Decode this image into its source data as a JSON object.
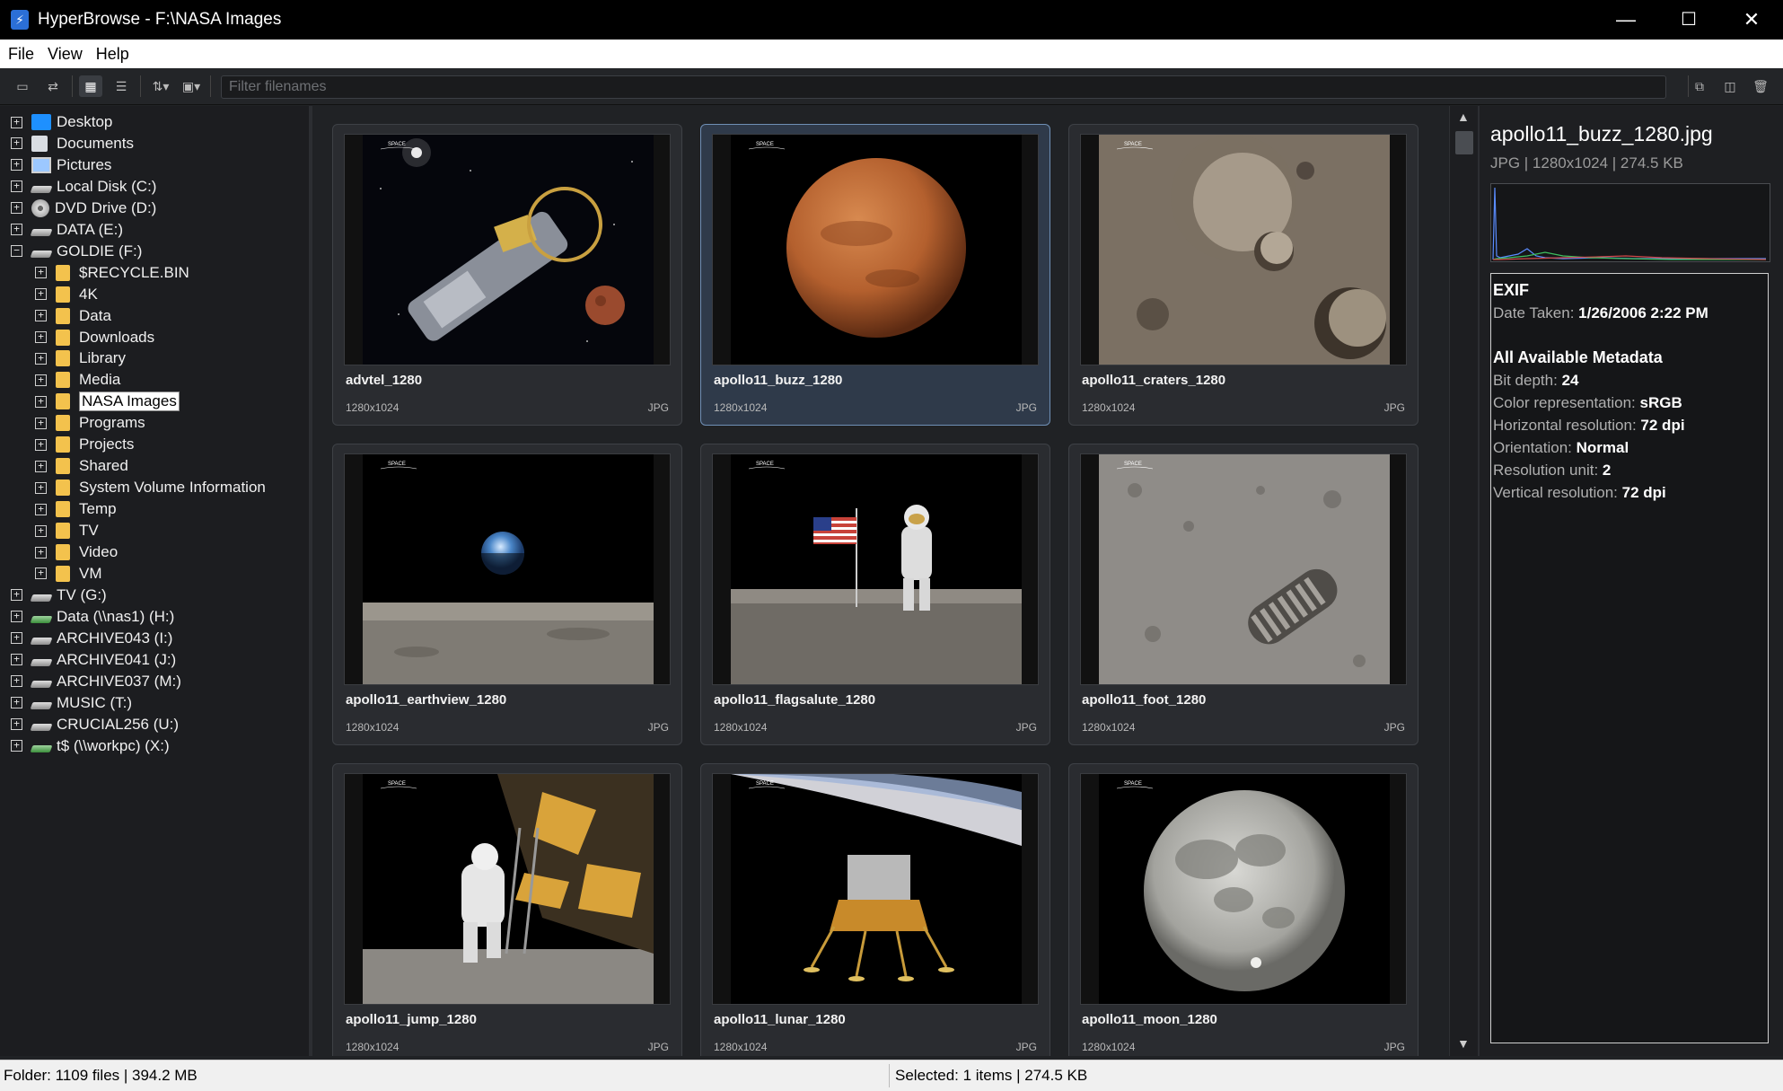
{
  "window": {
    "title": "HyperBrowse - F:\\NASA Images",
    "minimize_glyph": "—",
    "maximize_glyph": "☐",
    "close_glyph": "✕"
  },
  "menu": [
    "File",
    "View",
    "Help"
  ],
  "toolbar": {
    "filter_placeholder": "Filter filenames",
    "filter_value": ""
  },
  "tree": [
    {
      "label": "Desktop",
      "level": 0,
      "icon": "desktop-icon",
      "expander": "+"
    },
    {
      "label": "Documents",
      "level": 0,
      "icon": "documents-icon",
      "expander": "+"
    },
    {
      "label": "Pictures",
      "level": 0,
      "icon": "pictures-icon",
      "expander": "+"
    },
    {
      "label": "Local Disk (C:)",
      "level": 0,
      "icon": "drive-icon",
      "expander": "+"
    },
    {
      "label": "DVD Drive (D:)",
      "level": 0,
      "icon": "dvd-icon",
      "expander": "+"
    },
    {
      "label": "DATA (E:)",
      "level": 0,
      "icon": "drive-icon",
      "expander": "+"
    },
    {
      "label": "GOLDIE (F:)",
      "level": 0,
      "icon": "drive-icon",
      "expander": "−"
    },
    {
      "label": "$RECYCLE.BIN",
      "level": 1,
      "icon": "folder-icon",
      "expander": "+"
    },
    {
      "label": "4K",
      "level": 1,
      "icon": "folder-icon",
      "expander": "+"
    },
    {
      "label": "Data",
      "level": 1,
      "icon": "folder-icon",
      "expander": "+"
    },
    {
      "label": "Downloads",
      "level": 1,
      "icon": "folder-icon",
      "expander": "+"
    },
    {
      "label": "Library",
      "level": 1,
      "icon": "folder-icon",
      "expander": "+"
    },
    {
      "label": "Media",
      "level": 1,
      "icon": "folder-icon",
      "expander": "+"
    },
    {
      "label": "NASA Images",
      "level": 1,
      "icon": "folder-icon",
      "expander": "+",
      "selected": true
    },
    {
      "label": "Programs",
      "level": 1,
      "icon": "folder-icon",
      "expander": "+"
    },
    {
      "label": "Projects",
      "level": 1,
      "icon": "folder-icon",
      "expander": "+"
    },
    {
      "label": "Shared",
      "level": 1,
      "icon": "folder-icon",
      "expander": "+"
    },
    {
      "label": "System Volume Information",
      "level": 1,
      "icon": "folder-icon",
      "expander": "+"
    },
    {
      "label": "Temp",
      "level": 1,
      "icon": "folder-icon",
      "expander": "+"
    },
    {
      "label": "TV",
      "level": 1,
      "icon": "folder-icon",
      "expander": "+"
    },
    {
      "label": "Video",
      "level": 1,
      "icon": "folder-icon",
      "expander": "+"
    },
    {
      "label": "VM",
      "level": 1,
      "icon": "folder-icon",
      "expander": "+"
    },
    {
      "label": "TV (G:)",
      "level": 0,
      "icon": "drive-icon",
      "expander": "+"
    },
    {
      "label": "Data (\\\\nas1) (H:)",
      "level": 0,
      "icon": "network-drive-icon",
      "expander": "+"
    },
    {
      "label": "ARCHIVE043 (I:)",
      "level": 0,
      "icon": "drive-icon",
      "expander": "+"
    },
    {
      "label": "ARCHIVE041 (J:)",
      "level": 0,
      "icon": "drive-icon",
      "expander": "+"
    },
    {
      "label": "ARCHIVE037 (M:)",
      "level": 0,
      "icon": "drive-icon",
      "expander": "+"
    },
    {
      "label": "MUSIC (T:)",
      "level": 0,
      "icon": "drive-icon",
      "expander": "+"
    },
    {
      "label": "CRUCIAL256 (U:)",
      "level": 0,
      "icon": "drive-icon",
      "expander": "+"
    },
    {
      "label": "t$ (\\\\workpc) (X:)",
      "level": 0,
      "icon": "network-drive-icon",
      "expander": "+"
    }
  ],
  "thumbnails": [
    {
      "name": "advtel_1280",
      "dims": "1280x1024",
      "type": "JPG",
      "image": "space-telescope"
    },
    {
      "name": "apollo11_buzz_1280",
      "dims": "1280x1024",
      "type": "JPG",
      "image": "mars",
      "selected": true
    },
    {
      "name": "apollo11_craters_1280",
      "dims": "1280x1024",
      "type": "JPG",
      "image": "craters"
    },
    {
      "name": "apollo11_earthview_1280",
      "dims": "1280x1024",
      "type": "JPG",
      "image": "earthrise"
    },
    {
      "name": "apollo11_flagsalute_1280",
      "dims": "1280x1024",
      "type": "JPG",
      "image": "flag-salute"
    },
    {
      "name": "apollo11_foot_1280",
      "dims": "1280x1024",
      "type": "JPG",
      "image": "footprint"
    },
    {
      "name": "apollo11_jump_1280",
      "dims": "1280x1024",
      "type": "JPG",
      "image": "astronaut-ladder"
    },
    {
      "name": "apollo11_lunar_1280",
      "dims": "1280x1024",
      "type": "JPG",
      "image": "lunar-module"
    },
    {
      "name": "apollo11_moon_1280",
      "dims": "1280x1024",
      "type": "JPG",
      "image": "full-moon"
    }
  ],
  "info": {
    "filename": "apollo11_buzz_1280.jpg",
    "summary": "JPG | 1280x1024 | 274.5 KB",
    "exif_heading": "EXIF",
    "exif": [
      {
        "label": "Date Taken: ",
        "value": "1/26/2006 2:22 PM"
      }
    ],
    "meta_heading": "All Available Metadata",
    "metadata": [
      {
        "label": "Bit depth: ",
        "value": "24"
      },
      {
        "label": "Color representation: ",
        "value": "sRGB"
      },
      {
        "label": "Horizontal resolution: ",
        "value": "72 dpi"
      },
      {
        "label": "Orientation: ",
        "value": "Normal"
      },
      {
        "label": "Resolution unit: ",
        "value": "2"
      },
      {
        "label": "Vertical resolution: ",
        "value": "72 dpi"
      }
    ]
  },
  "status": {
    "left": "Folder: 1109 files | 394.2 MB",
    "right": "Selected: 1 items | 274.5 KB"
  },
  "colors": {
    "accent": "#6f8fb5",
    "folder": "#f3c24d"
  }
}
